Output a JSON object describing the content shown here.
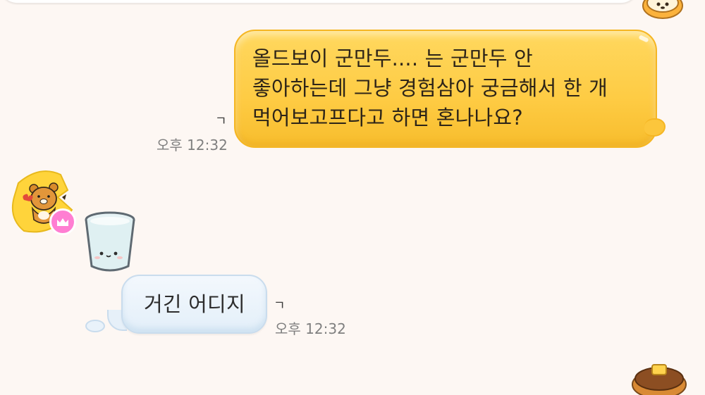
{
  "chat": {
    "messages": [
      {
        "direction": "outgoing",
        "text": "올드보이 군만두.... 는 군만두 안\n좋아하는데 그냥 경험삼아 궁금해서 한 개\n먹어보고프다고 하면 혼나나요?",
        "time": "오후 12:32",
        "read_mark": "ㄱ"
      },
      {
        "direction": "incoming",
        "sender_avatar_icon": "ryan-bear-avatar-icon",
        "sticker_icon": "water-cup-sticker-icon",
        "text": "거긴 어디지",
        "time": "오후 12:32",
        "read_mark": "ㄱ"
      }
    ]
  },
  "colors": {
    "background": "#fdf7f3",
    "outgoing_bubble": "#fecb43",
    "incoming_bubble": "#e3eff9",
    "time_text": "#7f7f7f"
  },
  "icons": {
    "crown_badge": "crown-icon",
    "top_corner": "pancake-sticker-icon",
    "bottom_corner": "pancake-sticker-icon"
  }
}
